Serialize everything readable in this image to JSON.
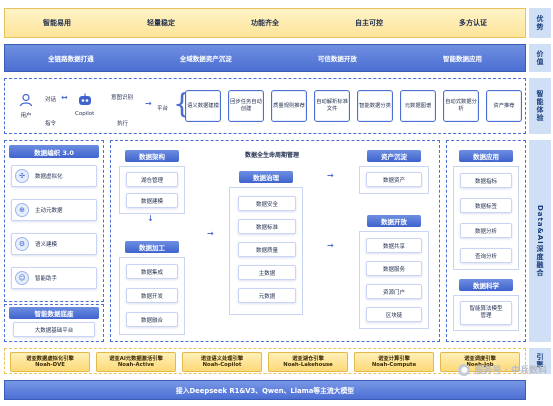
{
  "tags": {
    "advantage": "优势",
    "value": "价值",
    "ability": "智能体验",
    "data_ai": "Data&AI深度融合",
    "engine": "引擎"
  },
  "advantages": [
    "智能易用",
    "轻量稳定",
    "功能齐全",
    "自主可控",
    "多方认证"
  ],
  "values": [
    "全链路数据打通",
    "全域数据资产沉淀",
    "可信数据开放",
    "智能数据应用"
  ],
  "ability": {
    "user": "用户",
    "dialog": "对话",
    "command": "指令",
    "copilot": "Copilot",
    "intent": "意图识别",
    "execute": "执行",
    "platform": "平台",
    "boxes": [
      "语义数据建模",
      "回步任务自动创建",
      "质量规则推荐",
      "自动解析标准文件",
      "智能数据分类",
      "元数据图谱",
      "自动式数据分析",
      "资产推荐"
    ]
  },
  "left_panel": {
    "title": "数据编织 3.0",
    "items": [
      "数据虚拟化",
      "主动元数据",
      "语义建模",
      "智能助手"
    ],
    "base_title": "智能数据底座",
    "base_item": "大数据基础平台"
  },
  "architecture": {
    "title": "数据架构",
    "items": [
      "湖仓管理",
      "数据建模"
    ]
  },
  "processing": {
    "title": "数据加工",
    "items": [
      "数据集成",
      "数据开发",
      "数据融合"
    ]
  },
  "lifecycle_title": "数据全生命周期管理",
  "governance": {
    "title": "数据治理",
    "items": [
      "数据安全",
      "数据标准",
      "数据质量",
      "主数据",
      "元数据"
    ]
  },
  "asset": {
    "title": "资产沉淀",
    "items": [
      "数据资产"
    ]
  },
  "open": {
    "title": "数据开放",
    "items": [
      "数据共享",
      "数据服务",
      "资源门户",
      "区块链"
    ]
  },
  "application": {
    "title": "数据应用",
    "items": [
      "数据指标",
      "数据标签",
      "数据分析",
      "查询分析"
    ]
  },
  "science": {
    "title": "数据科学",
    "items": [
      "智能算法模型管理"
    ]
  },
  "engines": [
    {
      "name": "诺亚数据虚拟化引擎",
      "code": "Noah-DVE"
    },
    {
      "name": "诺亚AI元数据激活引擎",
      "code": "Noah-Active"
    },
    {
      "name": "诺亚语义处理引擎",
      "code": "Noah-Copilot"
    },
    {
      "name": "诺亚湖仓引擎",
      "code": "Noah-Lakehouse"
    },
    {
      "name": "诺亚计算引擎",
      "code": "Noah-Compute"
    },
    {
      "name": "诺亚调度引擎",
      "code": "Noah-Job"
    }
  ],
  "bottom": "接入Deepseek R1&V3、Qwen、Llama等主流大模型",
  "watermark": "服务号 · 中兵数科"
}
